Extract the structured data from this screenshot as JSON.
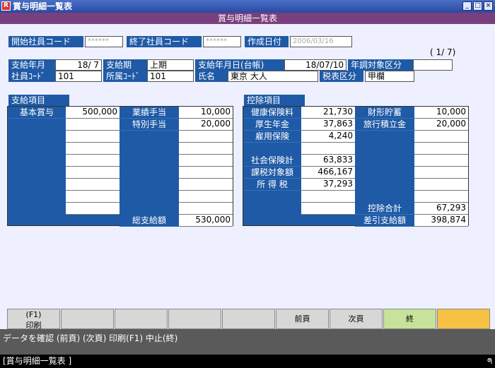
{
  "window": {
    "title": "賞与明細一覧表",
    "app_icon": "R",
    "subtitle": "賞与明細一覧表"
  },
  "search": {
    "start_code_label": "開始社員コード",
    "start_code_value": "******",
    "end_code_label": "終了社員コード",
    "end_code_value": "******",
    "created_label": "作成日付",
    "created_value": "2006/03/16"
  },
  "page_indicator": "( 1/ 7)",
  "header": {
    "pay_month_label": "支給年月",
    "pay_month": "18/ 7",
    "period_label": "支給期",
    "period": "上期",
    "pay_date_label": "支給年月日(台帳)",
    "pay_date": "18/07/10",
    "adjust_label": "年調対象区分",
    "adjust_value": "",
    "emp_code_label": "社員ｺｰﾄﾞ",
    "emp_code": "101",
    "dept_code_label": "所属ｺｰﾄﾞ",
    "dept_code": "101",
    "name_label": "氏名",
    "name": "東京 大人",
    "tax_label": "税表区分",
    "tax_value": "甲欄"
  },
  "payments": {
    "title": "支給項目",
    "items": [
      {
        "label": "基本賞与",
        "value": "500,000"
      },
      {
        "label": "業績手当",
        "value": "10,000"
      },
      {
        "label": "特別手当",
        "value": "20,000"
      }
    ],
    "total_label": "総支給額",
    "total": "530,000"
  },
  "deductions": {
    "title": "控除項目",
    "items": [
      {
        "label": "健康保険料",
        "value": "21,730"
      },
      {
        "label": "厚生年金",
        "value": "37,863"
      },
      {
        "label": "雇用保険",
        "value": "4,240"
      },
      {
        "label": "社会保険計",
        "value": "63,833"
      },
      {
        "label": "課税対象額",
        "value": "466,167"
      },
      {
        "label": "所 得 税",
        "value": "37,293"
      }
    ],
    "right_items": [
      {
        "label": "財形貯蓄",
        "value": "10,000"
      },
      {
        "label": "旅行積立金",
        "value": "20,000"
      }
    ],
    "total_label": "控除合計",
    "total": "67,293",
    "net_label": "差引支給額",
    "net": "398,874"
  },
  "fkeys": [
    {
      "label": "(F1)",
      "sub": "印刷"
    },
    {
      "label": ""
    },
    {
      "label": ""
    },
    {
      "label": ""
    },
    {
      "label": ""
    },
    {
      "label": "前頁"
    },
    {
      "label": "次頁"
    },
    {
      "label": "終"
    },
    {
      "label": ""
    }
  ],
  "status_message": "データを確認 (前頁) (次頁) 印刷(F1) 中止(終)",
  "bottom_text": "[賞与明細一覧表 ]",
  "bottom_icon": "ᖗ",
  "colors": {
    "label_blue": "#1f5aa6",
    "subtitle": "#7a3f7e",
    "key_green": "#c7e29a",
    "key_orange": "#f7c145"
  }
}
